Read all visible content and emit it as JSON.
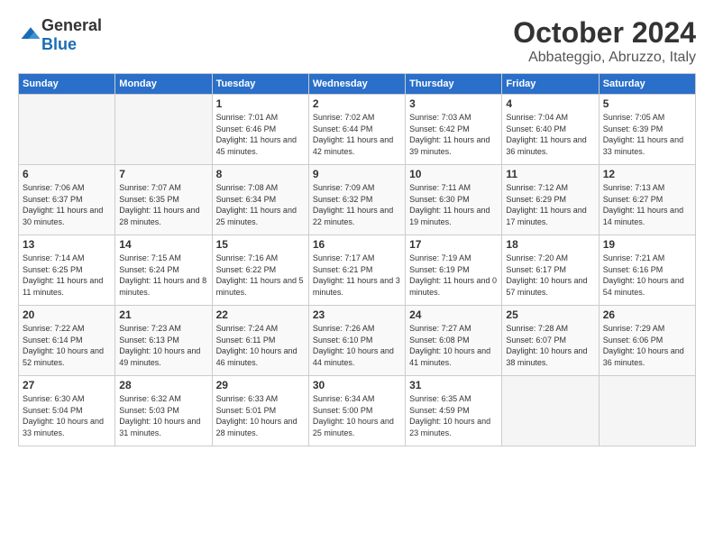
{
  "logo": {
    "general": "General",
    "blue": "Blue"
  },
  "header": {
    "month": "October 2024",
    "location": "Abbateggio, Abruzzo, Italy"
  },
  "weekdays": [
    "Sunday",
    "Monday",
    "Tuesday",
    "Wednesday",
    "Thursday",
    "Friday",
    "Saturday"
  ],
  "weeks": [
    [
      {
        "day": "",
        "info": ""
      },
      {
        "day": "",
        "info": ""
      },
      {
        "day": "1",
        "info": "Sunrise: 7:01 AM\nSunset: 6:46 PM\nDaylight: 11 hours and 45 minutes."
      },
      {
        "day": "2",
        "info": "Sunrise: 7:02 AM\nSunset: 6:44 PM\nDaylight: 11 hours and 42 minutes."
      },
      {
        "day": "3",
        "info": "Sunrise: 7:03 AM\nSunset: 6:42 PM\nDaylight: 11 hours and 39 minutes."
      },
      {
        "day": "4",
        "info": "Sunrise: 7:04 AM\nSunset: 6:40 PM\nDaylight: 11 hours and 36 minutes."
      },
      {
        "day": "5",
        "info": "Sunrise: 7:05 AM\nSunset: 6:39 PM\nDaylight: 11 hours and 33 minutes."
      }
    ],
    [
      {
        "day": "6",
        "info": "Sunrise: 7:06 AM\nSunset: 6:37 PM\nDaylight: 11 hours and 30 minutes."
      },
      {
        "day": "7",
        "info": "Sunrise: 7:07 AM\nSunset: 6:35 PM\nDaylight: 11 hours and 28 minutes."
      },
      {
        "day": "8",
        "info": "Sunrise: 7:08 AM\nSunset: 6:34 PM\nDaylight: 11 hours and 25 minutes."
      },
      {
        "day": "9",
        "info": "Sunrise: 7:09 AM\nSunset: 6:32 PM\nDaylight: 11 hours and 22 minutes."
      },
      {
        "day": "10",
        "info": "Sunrise: 7:11 AM\nSunset: 6:30 PM\nDaylight: 11 hours and 19 minutes."
      },
      {
        "day": "11",
        "info": "Sunrise: 7:12 AM\nSunset: 6:29 PM\nDaylight: 11 hours and 17 minutes."
      },
      {
        "day": "12",
        "info": "Sunrise: 7:13 AM\nSunset: 6:27 PM\nDaylight: 11 hours and 14 minutes."
      }
    ],
    [
      {
        "day": "13",
        "info": "Sunrise: 7:14 AM\nSunset: 6:25 PM\nDaylight: 11 hours and 11 minutes."
      },
      {
        "day": "14",
        "info": "Sunrise: 7:15 AM\nSunset: 6:24 PM\nDaylight: 11 hours and 8 minutes."
      },
      {
        "day": "15",
        "info": "Sunrise: 7:16 AM\nSunset: 6:22 PM\nDaylight: 11 hours and 5 minutes."
      },
      {
        "day": "16",
        "info": "Sunrise: 7:17 AM\nSunset: 6:21 PM\nDaylight: 11 hours and 3 minutes."
      },
      {
        "day": "17",
        "info": "Sunrise: 7:19 AM\nSunset: 6:19 PM\nDaylight: 11 hours and 0 minutes."
      },
      {
        "day": "18",
        "info": "Sunrise: 7:20 AM\nSunset: 6:17 PM\nDaylight: 10 hours and 57 minutes."
      },
      {
        "day": "19",
        "info": "Sunrise: 7:21 AM\nSunset: 6:16 PM\nDaylight: 10 hours and 54 minutes."
      }
    ],
    [
      {
        "day": "20",
        "info": "Sunrise: 7:22 AM\nSunset: 6:14 PM\nDaylight: 10 hours and 52 minutes."
      },
      {
        "day": "21",
        "info": "Sunrise: 7:23 AM\nSunset: 6:13 PM\nDaylight: 10 hours and 49 minutes."
      },
      {
        "day": "22",
        "info": "Sunrise: 7:24 AM\nSunset: 6:11 PM\nDaylight: 10 hours and 46 minutes."
      },
      {
        "day": "23",
        "info": "Sunrise: 7:26 AM\nSunset: 6:10 PM\nDaylight: 10 hours and 44 minutes."
      },
      {
        "day": "24",
        "info": "Sunrise: 7:27 AM\nSunset: 6:08 PM\nDaylight: 10 hours and 41 minutes."
      },
      {
        "day": "25",
        "info": "Sunrise: 7:28 AM\nSunset: 6:07 PM\nDaylight: 10 hours and 38 minutes."
      },
      {
        "day": "26",
        "info": "Sunrise: 7:29 AM\nSunset: 6:06 PM\nDaylight: 10 hours and 36 minutes."
      }
    ],
    [
      {
        "day": "27",
        "info": "Sunrise: 6:30 AM\nSunset: 5:04 PM\nDaylight: 10 hours and 33 minutes."
      },
      {
        "day": "28",
        "info": "Sunrise: 6:32 AM\nSunset: 5:03 PM\nDaylight: 10 hours and 31 minutes."
      },
      {
        "day": "29",
        "info": "Sunrise: 6:33 AM\nSunset: 5:01 PM\nDaylight: 10 hours and 28 minutes."
      },
      {
        "day": "30",
        "info": "Sunrise: 6:34 AM\nSunset: 5:00 PM\nDaylight: 10 hours and 25 minutes."
      },
      {
        "day": "31",
        "info": "Sunrise: 6:35 AM\nSunset: 4:59 PM\nDaylight: 10 hours and 23 minutes."
      },
      {
        "day": "",
        "info": ""
      },
      {
        "day": "",
        "info": ""
      }
    ]
  ]
}
